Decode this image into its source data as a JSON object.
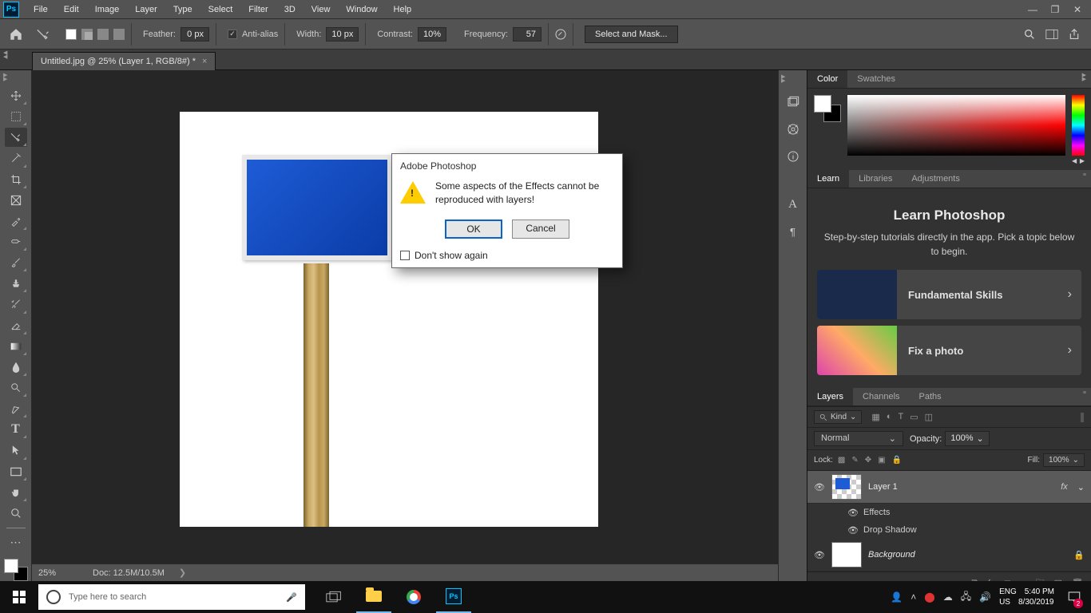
{
  "menu": {
    "items": [
      "File",
      "Edit",
      "Image",
      "Layer",
      "Type",
      "Select",
      "Filter",
      "3D",
      "View",
      "Window",
      "Help"
    ]
  },
  "options": {
    "feather_label": "Feather:",
    "feather_value": "0 px",
    "antialias_label": "Anti-alias",
    "width_label": "Width:",
    "width_value": "10 px",
    "contrast_label": "Contrast:",
    "contrast_value": "10%",
    "frequency_label": "Frequency:",
    "frequency_value": "57",
    "select_mask": "Select and Mask..."
  },
  "tab": {
    "title": "Untitled.jpg @ 25% (Layer 1, RGB/8#) *"
  },
  "status": {
    "zoom": "25%",
    "doc": "Doc: 12.5M/10.5M"
  },
  "panel_color": {
    "tabs": [
      "Color",
      "Swatches"
    ]
  },
  "panel_learn": {
    "tabs": [
      "Learn",
      "Libraries",
      "Adjustments"
    ],
    "title": "Learn Photoshop",
    "subtitle": "Step-by-step tutorials directly in the app. Pick a topic below to begin.",
    "cards": [
      {
        "label": "Fundamental Skills"
      },
      {
        "label": "Fix a photo"
      }
    ]
  },
  "panel_layers": {
    "tabs": [
      "Layers",
      "Channels",
      "Paths"
    ],
    "filter": "Kind",
    "blend_mode": "Normal",
    "opacity_label": "Opacity:",
    "opacity_value": "100%",
    "lock_label": "Lock:",
    "fill_label": "Fill:",
    "fill_value": "100%",
    "rows": [
      {
        "name": "Layer 1",
        "fx": "fx",
        "sub": [
          "Effects",
          "Drop Shadow"
        ]
      },
      {
        "name": "Background",
        "locked": true
      }
    ]
  },
  "dialog": {
    "title": "Adobe Photoshop",
    "message": "Some aspects of the Effects cannot be reproduced with layers!",
    "ok": "OK",
    "cancel": "Cancel",
    "dontshow": "Don't show again"
  },
  "taskbar": {
    "search_placeholder": "Type here to search",
    "lang1": "ENG",
    "lang2": "US",
    "time": "5:40 PM",
    "date": "8/30/2019",
    "notif_count": "2"
  }
}
